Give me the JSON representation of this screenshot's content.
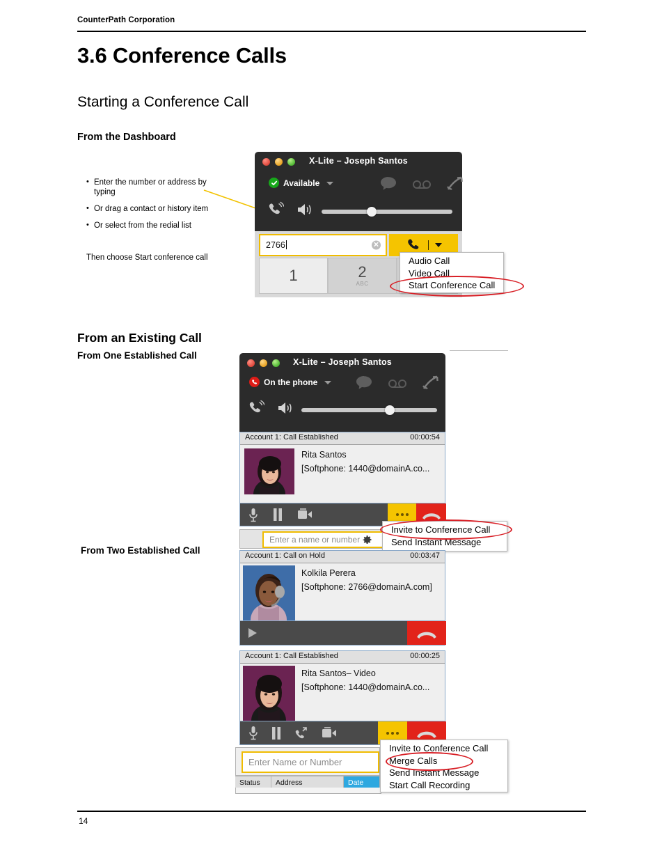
{
  "document": {
    "running_header": "CounterPath Corporation",
    "chapter_title": "3.6 Conference Calls",
    "section_title": "Starting a Conference Call",
    "subsection_dashboard": "From the Dashboard",
    "subsection_existing": "From an Existing Call",
    "subsection_one_call": "From One Established Call",
    "subsection_two_calls": "From Two Established Call",
    "page_number": "14"
  },
  "instructions": {
    "bullets": [
      "Enter the number or address by typing",
      "Or drag a contact or history item",
      "Or select from the redial list"
    ],
    "closing": "Then choose Start conference call"
  },
  "screenshot_dashboard": {
    "window_title": "X-Lite – Joseph Santos",
    "presence_status": "Available",
    "presence_icon": "check-circle-icon",
    "top_icons": [
      "chat-bubble-icon",
      "voicemail-icon",
      "call-forward-icon"
    ],
    "volume_icons": [
      "ringer-icon",
      "speaker-icon"
    ],
    "dial_value": "2766",
    "clear_icon": "clear-x-icon",
    "call_icon": "phone-handset-icon",
    "dropdown_icon": "caret-down-icon",
    "keys": [
      {
        "num": "1",
        "letters": ""
      },
      {
        "num": "2",
        "letters": "ABC"
      }
    ],
    "menu": {
      "items": [
        "Audio Call",
        "Video Call",
        "Start Conference Call"
      ],
      "highlighted": "Start Conference Call"
    }
  },
  "screenshot_one_call": {
    "window_title": "X-Lite – Joseph Santos",
    "presence_status": "On the phone",
    "presence_icon": "phone-busy-icon",
    "top_icons": [
      "chat-bubble-icon",
      "voicemail-icon",
      "call-forward-icon"
    ],
    "call": {
      "account": "Account 1: Call Established",
      "duration": "00:00:54",
      "name": "Rita Santos",
      "address": "[Softphone: 1440@domainA.co...",
      "avatar": "rita-santos-avatar"
    },
    "bar_icons": [
      "microphone-icon",
      "pause-icon",
      "video-share-icon"
    ],
    "more_icon": "more-dots-icon",
    "end_icon": "end-call-icon",
    "search_placeholder": "Enter a name or number",
    "gear_icon": "gear-icon",
    "menu": {
      "items": [
        "Invite to Conference Call",
        "Send Instant Message"
      ],
      "highlighted": "Invite to Conference Call"
    }
  },
  "screenshot_two_calls": {
    "call_hold": {
      "account": "Account 1: Call on Hold",
      "duration": "00:03:47",
      "name": "Kolkila  Perera",
      "address": "[Softphone: 2766@domainA.com]",
      "avatar": "kolkila-perera-avatar"
    },
    "hold_bar_icons": [
      "resume-play-icon"
    ],
    "hold_end_icon": "end-call-icon",
    "call_established": {
      "account": "Account 1: Call Established",
      "duration": "00:00:25",
      "name": "Rita Santos– Video",
      "address": "[Softphone: 1440@domainA.co...",
      "avatar": "rita-santos-avatar"
    },
    "bar_icons": [
      "microphone-icon",
      "pause-icon",
      "transfer-icon",
      "video-share-icon"
    ],
    "more_icon": "more-dots-icon",
    "end_icon": "end-call-icon",
    "search_placeholder": "Enter Name or Number",
    "table_columns": [
      "Status",
      "Address",
      "Date"
    ],
    "table_selected_column": "Date",
    "menu": {
      "items": [
        "Invite to Conference Call",
        "Merge Calls",
        "Send Instant Message",
        "Start Call Recording"
      ],
      "highlighted": "Merge Calls"
    }
  },
  "colors": {
    "accent_yellow": "#f5c400",
    "end_red": "#e2231a",
    "highlight_ellipse": "#d81f26",
    "window_dark": "#2b2b2b",
    "available_green": "#17a81a",
    "onphone_red": "#dd1c17",
    "selected_blue": "#2ea8e0"
  }
}
